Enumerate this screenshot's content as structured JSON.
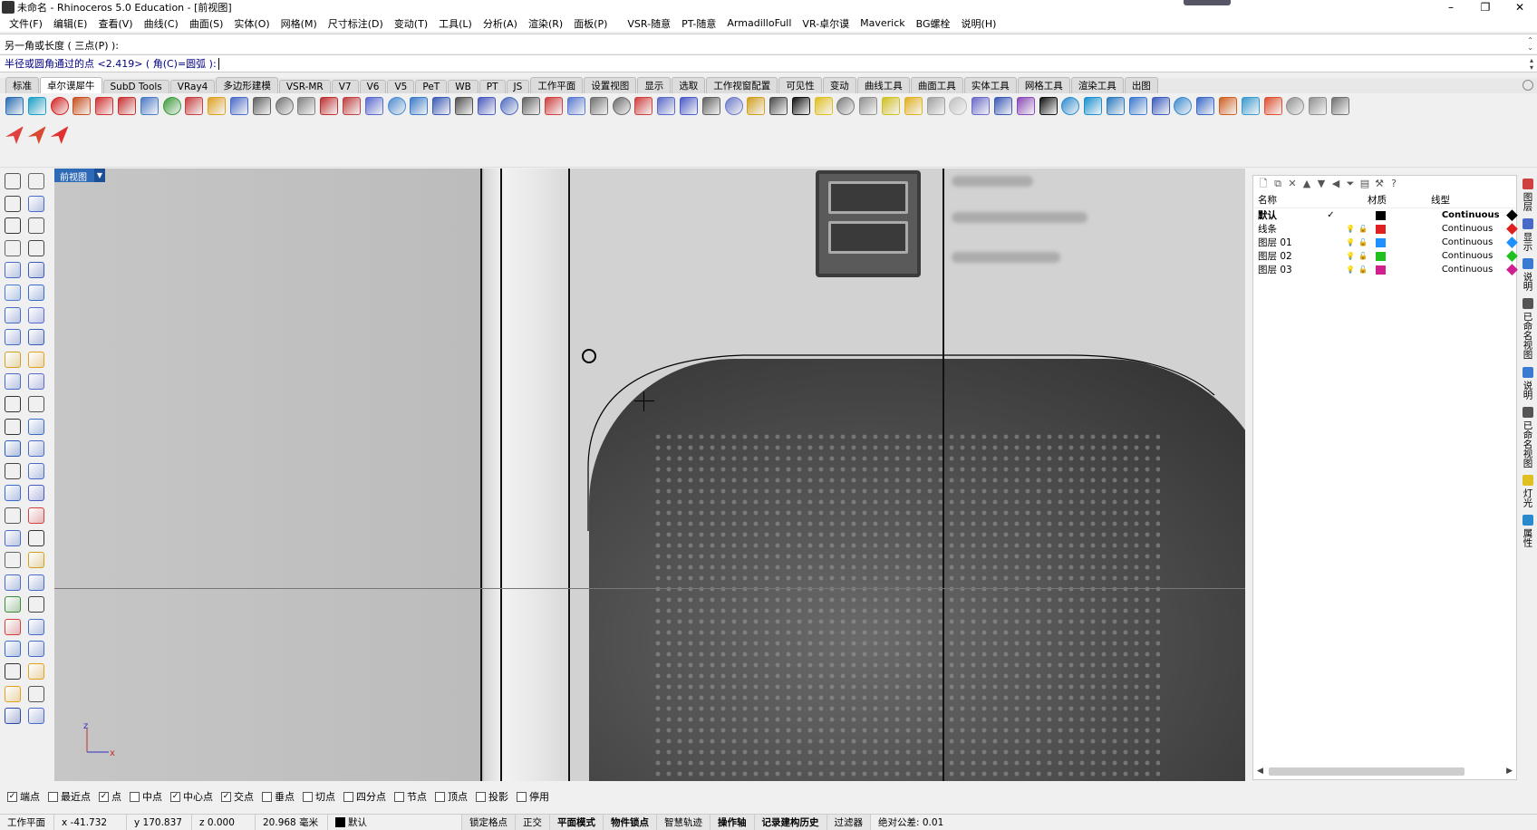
{
  "window": {
    "title": "未命名 - Rhinoceros 5.0 Education - [前视图]",
    "controls": [
      "–",
      "❐",
      "✕"
    ]
  },
  "menu": [
    "文件(F)",
    "编辑(E)",
    "查看(V)",
    "曲线(C)",
    "曲面(S)",
    "实体(O)",
    "网格(M)",
    "尺寸标注(D)",
    "变动(T)",
    "工具(L)",
    "分析(A)",
    "渲染(R)",
    "面板(P)",
    "VSR-随意",
    "PT-随意",
    "ArmadilloFull",
    "VR-卓尔谟",
    "Maverick",
    "BG螺栓",
    "说明(H)"
  ],
  "command": {
    "history": "另一角或长度 ( 三点(P) ):",
    "prompt": "半径或圆角通过的点 <2.419> ( 角(C)=圆弧 ):",
    "input_value": ""
  },
  "tabs": [
    {
      "label": "标准",
      "active": false
    },
    {
      "label": "卓尔谟犀牛",
      "active": true
    },
    {
      "label": "SubD Tools",
      "active": false
    },
    {
      "label": "VRay4",
      "active": false
    },
    {
      "label": "多边形建模",
      "active": false
    },
    {
      "label": "VSR-MR",
      "active": false
    },
    {
      "label": "V7",
      "active": false
    },
    {
      "label": "V6",
      "active": false
    },
    {
      "label": "V5",
      "active": false
    },
    {
      "label": "PeT",
      "active": false
    },
    {
      "label": "WB",
      "active": false
    },
    {
      "label": "PT",
      "active": false
    },
    {
      "label": "JS",
      "active": false
    },
    {
      "label": "工作平面",
      "active": false
    },
    {
      "label": "设置视图",
      "active": false
    },
    {
      "label": "显示",
      "active": false
    },
    {
      "label": "选取",
      "active": false
    },
    {
      "label": "工作视窗配置",
      "active": false
    },
    {
      "label": "可见性",
      "active": false
    },
    {
      "label": "变动",
      "active": false
    },
    {
      "label": "曲线工具",
      "active": false
    },
    {
      "label": "曲面工具",
      "active": false
    },
    {
      "label": "实体工具",
      "active": false
    },
    {
      "label": "网格工具",
      "active": false
    },
    {
      "label": "渲染工具",
      "active": false
    },
    {
      "label": "出图",
      "active": false
    }
  ],
  "toolbar_colors": [
    "#2a6db5",
    "#1aa0c8",
    "#d42020",
    "#c85020",
    "#d43030",
    "#c83030",
    "#4a7ac8",
    "#3a9a3a",
    "#c84040",
    "#e0a020",
    "#4a6ac8",
    "#606060",
    "#707070",
    "#808080",
    "#c03030",
    "#c04040",
    "#5a6ad0",
    "#4a8ad0",
    "#3a7ac8",
    "#3a5ab8",
    "#505050",
    "#4a5ac0",
    "#4a6ac0",
    "#606060",
    "#d04040",
    "#5a7ad0",
    "#707070",
    "#6a6a6a",
    "#d04040",
    "#5a6ac8",
    "#4a5ac8",
    "#606060",
    "#6a7ac8",
    "#d0a020",
    "#4a4a4a",
    "#101010",
    "#e0c020",
    "#7a7a7a",
    "#909090",
    "#d0c020",
    "#e0b020",
    "#a0a0a0",
    "#c0c0c0",
    "#6a6ac8",
    "#3a5ab8",
    "#8a4ab8",
    "#101010",
    "#2a8ad0",
    "#1a90d0",
    "#2a7ac0",
    "#3a7ad0",
    "#3a5ac0",
    "#3a8ad0",
    "#3a6ac8",
    "#d06020",
    "#3a9ad0",
    "#e05030",
    "#909090",
    "#909090",
    "#707070"
  ],
  "toolbar2_colors": [
    "#e04040",
    "#d84a30",
    "#e03030"
  ],
  "viewport": {
    "label": "前视图",
    "axis_z": "z",
    "axis_x": "x"
  },
  "layers": {
    "toolbar_icons": [
      "🗋",
      "⧉",
      "✕",
      "▲",
      "▼",
      "◀",
      "⏷",
      "▤",
      "⚒",
      "?"
    ],
    "header": {
      "name": "名称",
      "material": "材质",
      "linetype": "线型"
    },
    "rows": [
      {
        "name": "默认",
        "current": "✓",
        "color": "#000000",
        "linetype": "Continuous",
        "bold": true
      },
      {
        "name": "线条",
        "current": "",
        "color": "#e02020",
        "linetype": "Continuous",
        "bold": false
      },
      {
        "name": "图层 01",
        "current": "",
        "color": "#1e90ff",
        "linetype": "Continuous",
        "bold": false
      },
      {
        "name": "图层 02",
        "current": "",
        "color": "#20c020",
        "linetype": "Continuous",
        "bold": false
      },
      {
        "name": "图层 03",
        "current": "",
        "color": "#d02090",
        "linetype": "Continuous",
        "bold": false
      }
    ]
  },
  "side_tabs": [
    "图层",
    "显示",
    "说明",
    "已命名视图",
    "说明",
    "已命名视图",
    "灯光",
    "属性"
  ],
  "osnap": [
    {
      "label": "端点",
      "checked": true
    },
    {
      "label": "最近点",
      "checked": false
    },
    {
      "label": "点",
      "checked": true
    },
    {
      "label": "中点",
      "checked": false
    },
    {
      "label": "中心点",
      "checked": true
    },
    {
      "label": "交点",
      "checked": true
    },
    {
      "label": "垂点",
      "checked": false
    },
    {
      "label": "切点",
      "checked": false
    },
    {
      "label": "四分点",
      "checked": false
    },
    {
      "label": "节点",
      "checked": false
    },
    {
      "label": "顶点",
      "checked": false
    },
    {
      "label": "投影",
      "checked": false
    },
    {
      "label": "停用",
      "checked": false
    }
  ],
  "status": {
    "cplane": "工作平面",
    "x": "x -41.732",
    "y": "y 170.837",
    "z": "z 0.000",
    "units": "20.968 毫米",
    "layer": "默认",
    "buttons": [
      "锁定格点",
      "正交",
      "平面模式",
      "物件锁点",
      "智慧轨迹",
      "操作轴",
      "记录建构历史",
      "过滤器"
    ],
    "bold_buttons": [
      "平面模式",
      "物件锁点",
      "操作轴",
      "记录建构历史"
    ],
    "tolerance": "绝对公差: 0.01"
  }
}
